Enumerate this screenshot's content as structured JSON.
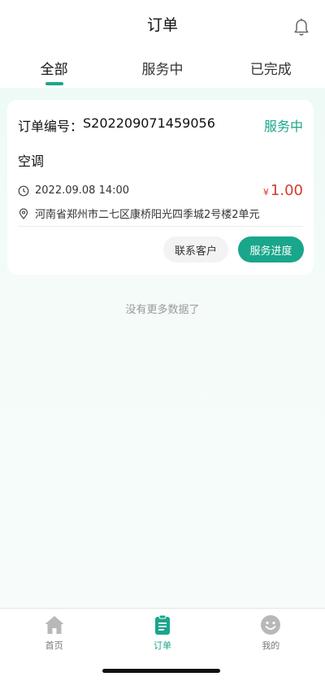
{
  "header": {
    "title": "订单",
    "bell_icon": "bell-icon"
  },
  "tabs": [
    {
      "label": "全部",
      "active": true
    },
    {
      "label": "服务中",
      "active": false
    },
    {
      "label": "已完成",
      "active": false
    }
  ],
  "order": {
    "order_no_label": "订单编号：",
    "order_no": "S202209071459056",
    "status": "服务中",
    "service": "空调",
    "time": "2022.09.08 14:00",
    "address": "河南省郑州市二七区康桥阳光四季城2号楼2单元",
    "currency": "¥",
    "price": "1.00",
    "contact_button": "联系客户",
    "progress_button": "服务进度"
  },
  "list_footer": "没有更多数据了",
  "tabbar": [
    {
      "label": "首页",
      "icon": "home-icon",
      "active": false
    },
    {
      "label": "订单",
      "icon": "order-icon",
      "active": true
    },
    {
      "label": "我的",
      "icon": "smile-icon",
      "active": false
    }
  ],
  "colors": {
    "accent": "#1aa68b",
    "price": "#d83a2c",
    "background": "#f4fbf9"
  }
}
